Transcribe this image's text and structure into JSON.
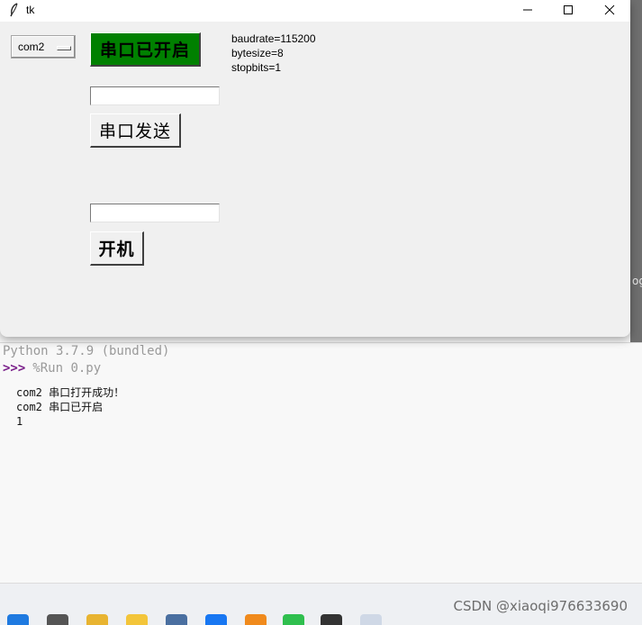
{
  "window": {
    "title": "tk"
  },
  "controls": {
    "port_select": {
      "value": "com2"
    },
    "open_button_label": "串口已开启",
    "send_input_value": "",
    "send_button_label": "串口发送",
    "power_input_value": "",
    "power_button_label": "开机",
    "open_button_color": "#008000"
  },
  "port_info": {
    "baudrate": "baudrate=115200",
    "bytesize": "bytesize=8",
    "stopbits": "stopbits=1"
  },
  "shell": {
    "banner": "Python 3.7.9 (bundled)",
    "prompt": ">>>",
    "command": "%Run 0.py",
    "output": [
      "com2 串口打开成功！",
      "com2 串口已开启",
      "1"
    ],
    "prompt_color": "#7a1f8a",
    "edge_fragment": "og"
  },
  "watermark": "CSDN @xiaoqi976633690",
  "taskbar_icons": [
    "windows-start-icon",
    "task-view-icon",
    "file-explorer-icon",
    "star-app-icon",
    "calculator-icon",
    "browser-icon",
    "media-app-icon",
    "wechat-icon",
    "text-tool-icon",
    "tk-feather-icon"
  ]
}
